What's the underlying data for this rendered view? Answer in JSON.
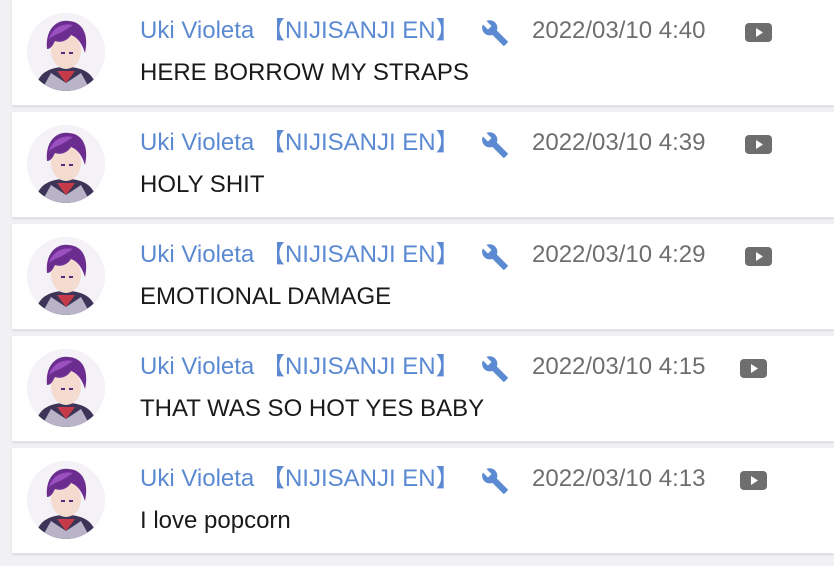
{
  "colors": {
    "name": "#5b8ad2",
    "timestamp": "#6e6e6e",
    "message": "#1a1a1a",
    "icon": "#5b8ad2",
    "youtube_icon": "#6e6e6e"
  },
  "icons": {
    "moderator": "wrench-icon",
    "source": "youtube-icon"
  },
  "messages": [
    {
      "author": "Uki Violeta 【NIJISANJI EN】",
      "timestamp": "2022/03/10 4:40",
      "text": "HERE BORROW MY STRAPS"
    },
    {
      "author": "Uki Violeta 【NIJISANJI EN】",
      "timestamp": "2022/03/10 4:39",
      "text": "HOLY SHIT"
    },
    {
      "author": "Uki Violeta 【NIJISANJI EN】",
      "timestamp": "2022/03/10 4:29",
      "text": "EMOTIONAL DAMAGE"
    },
    {
      "author": "Uki Violeta 【NIJISANJI EN】",
      "timestamp": "2022/03/10 4:15",
      "text": "THAT WAS SO HOT YES BABY"
    },
    {
      "author": "Uki Violeta 【NIJISANJI EN】",
      "timestamp": "2022/03/10 4:13",
      "text": "I love popcorn"
    }
  ]
}
